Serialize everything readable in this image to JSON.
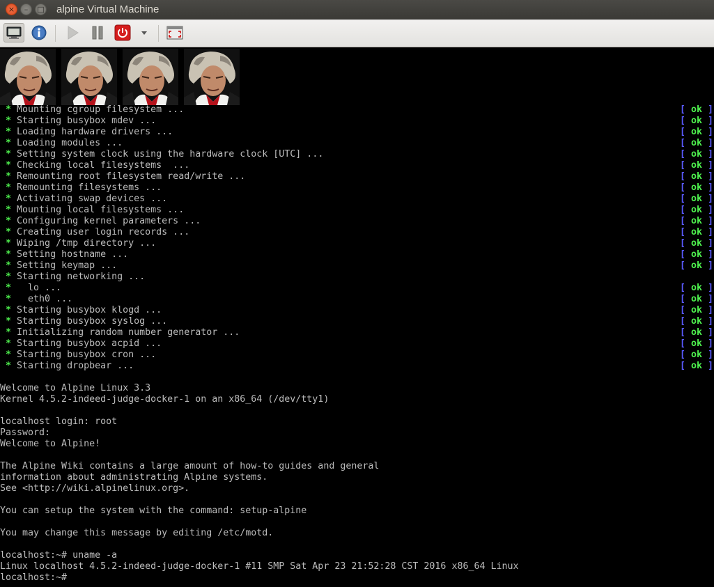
{
  "window": {
    "title": "alpine Virtual Machine",
    "close_glyph": "×",
    "min_glyph": "–",
    "max_glyph": "□"
  },
  "toolbar": {
    "buttons": [
      {
        "name": "console-view-icon",
        "state": "pressed"
      },
      {
        "name": "info-icon",
        "state": "normal"
      },
      {
        "name": "play-icon",
        "state": "disabled"
      },
      {
        "name": "pause-icon",
        "state": "normal"
      },
      {
        "name": "power-icon",
        "state": "normal"
      },
      {
        "name": "chevron-down-icon",
        "state": "normal"
      },
      {
        "name": "fullscreen-icon",
        "state": "normal"
      }
    ]
  },
  "colors": {
    "star": "#4ef04e",
    "ok": "#4ef04e",
    "bracket": "#5a5aff",
    "text": "#bcbcbc",
    "background": "#000000"
  },
  "boot": [
    {
      "star": " * ",
      "text": "Mounting cgroup filesystem ...",
      "status": "ok"
    },
    {
      "star": " * ",
      "text": "Starting busybox mdev ...",
      "status": "ok"
    },
    {
      "star": " * ",
      "text": "Loading hardware drivers ...",
      "status": "ok"
    },
    {
      "star": " * ",
      "text": "Loading modules ...",
      "status": "ok"
    },
    {
      "star": " * ",
      "text": "Setting system clock using the hardware clock [UTC] ...",
      "status": "ok"
    },
    {
      "star": " * ",
      "text": "Checking local filesystems  ...",
      "status": "ok"
    },
    {
      "star": " * ",
      "text": "Remounting root filesystem read/write ...",
      "status": "ok"
    },
    {
      "star": " * ",
      "text": "Remounting filesystems ...",
      "status": "ok"
    },
    {
      "star": " * ",
      "text": "Activating swap devices ...",
      "status": "ok"
    },
    {
      "star": " * ",
      "text": "Mounting local filesystems ...",
      "status": "ok"
    },
    {
      "star": " * ",
      "text": "Configuring kernel parameters ...",
      "status": "ok"
    },
    {
      "star": " * ",
      "text": "Creating user login records ...",
      "status": "ok"
    },
    {
      "star": " * ",
      "text": "Wiping /tmp directory ...",
      "status": "ok"
    },
    {
      "star": " * ",
      "text": "Setting hostname ...",
      "status": "ok"
    },
    {
      "star": " * ",
      "text": "Setting keymap ...",
      "status": "ok"
    },
    {
      "star": " * ",
      "text": "Starting networking ...",
      "status": ""
    },
    {
      "star": " * ",
      "text": "  lo ...",
      "status": "ok"
    },
    {
      "star": " * ",
      "text": "  eth0 ...",
      "status": "ok"
    },
    {
      "star": " * ",
      "text": "Starting busybox klogd ...",
      "status": "ok"
    },
    {
      "star": " * ",
      "text": "Starting busybox syslog ...",
      "status": "ok"
    },
    {
      "star": " * ",
      "text": "Initializing random number generator ...",
      "status": "ok"
    },
    {
      "star": " * ",
      "text": "Starting busybox acpid ...",
      "status": "ok"
    },
    {
      "star": " * ",
      "text": "Starting busybox cron ...",
      "status": "ok"
    },
    {
      "star": " * ",
      "text": "Starting dropbear ...",
      "status": "ok"
    }
  ],
  "ok_bracket_open": "[ ",
  "ok_bracket_close": " ]",
  "console_lines": [
    "",
    "Welcome to Alpine Linux 3.3",
    "Kernel 4.5.2-indeed-judge-docker-1 on an x86_64 (/dev/tty1)",
    "",
    "localhost login: root",
    "Password:",
    "Welcome to Alpine!",
    "",
    "The Alpine Wiki contains a large amount of how-to guides and general",
    "information about administrating Alpine systems.",
    "See <http://wiki.alpinelinux.org>.",
    "",
    "You can setup the system with the command: setup-alpine",
    "",
    "You may change this message by editing /etc/motd.",
    "",
    "localhost:~# uname -a",
    "Linux localhost 4.5.2-indeed-judge-docker-1 #11 SMP Sat Apr 23 21:52:28 CST 2016 x86_64 Linux",
    "localhost:~#"
  ]
}
